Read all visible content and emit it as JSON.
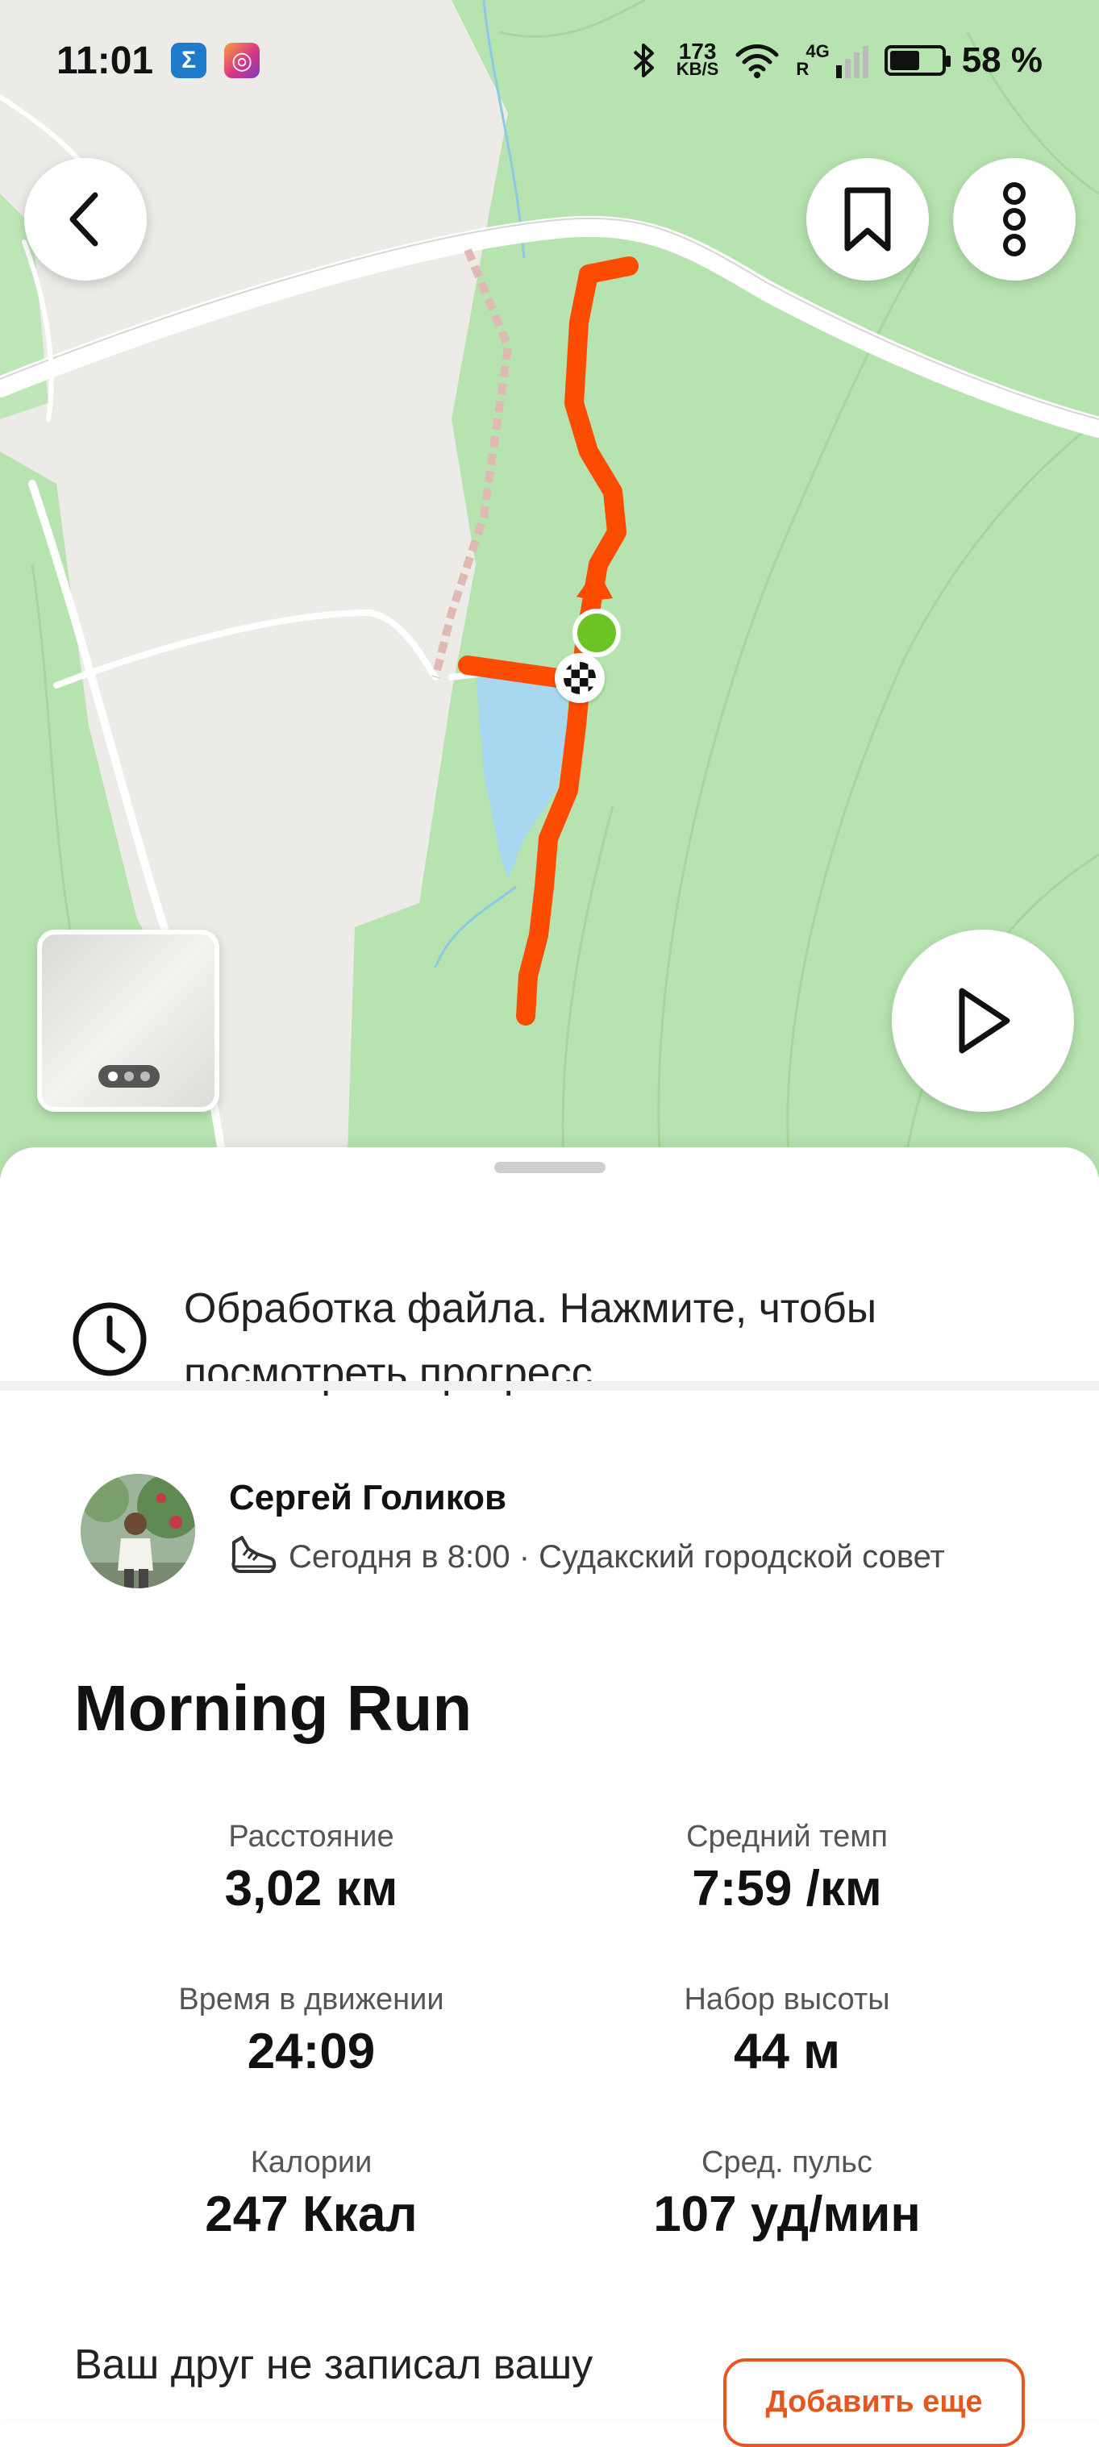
{
  "status_bar": {
    "time": "11:01",
    "network_speed_value": "173",
    "network_speed_unit": "KB/S",
    "cellular_label": "4G",
    "roaming_label": "R",
    "battery": "58 %",
    "battery_level": 0.58,
    "apps": [
      {
        "name": "sigma-app-icon",
        "glyph": "Σ"
      },
      {
        "name": "instagram-icon",
        "glyph": "◎"
      }
    ]
  },
  "map": {
    "route_color": "#fc4c02",
    "water_color": "#a8d8f0",
    "forest_color": "#b7e3b0",
    "start_marker_color": "#6cc424",
    "buttons": {
      "back": "chevron-left-icon",
      "save": "bookmark-icon",
      "more": "more-vertical-icon",
      "play": "play-icon"
    },
    "style_selector_active_page": 1,
    "style_selector_pages": 3
  },
  "processing": {
    "text": "Обработка файла. Нажмите, чтобы посмотреть прогресс."
  },
  "athlete": {
    "name": "Сергей Голиков",
    "meta": "Сегодня в 8:00 · Судакский городской совет"
  },
  "activity": {
    "title": "Morning Run",
    "stats": [
      {
        "label": "Расстояние",
        "value": "3,02 км"
      },
      {
        "label": "Средний темп",
        "value": "7:59 /км"
      },
      {
        "label": "Время в движении",
        "value": "24:09"
      },
      {
        "label": "Набор высоты",
        "value": "44 м"
      },
      {
        "label": "Калории",
        "value": "247 Ккал"
      },
      {
        "label": "Сред. пульс",
        "value": "107 уд/мин"
      }
    ]
  },
  "friend_prompt": {
    "text": "Ваш друг не записал вашу",
    "button": "Добавить еще"
  },
  "accent_color": "#e8561e"
}
